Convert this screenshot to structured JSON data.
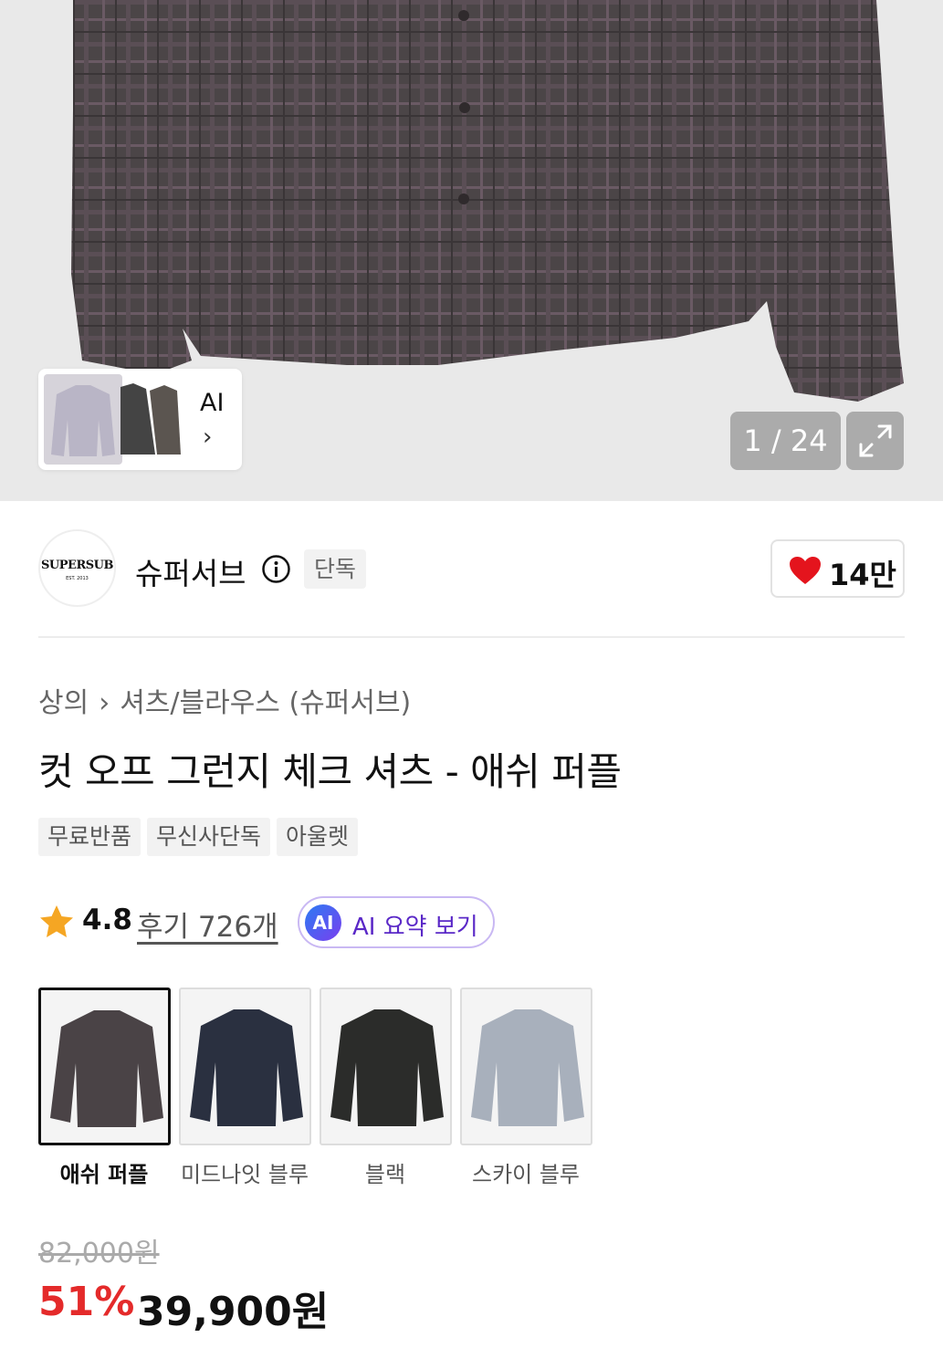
{
  "gallery": {
    "ai_label": "AI",
    "counter": "1 / 24"
  },
  "brand": {
    "logo_text": "SUPERSUB",
    "logo_subtext": "EST. 2013",
    "name": "슈퍼서브",
    "exclusive_badge": "단독",
    "like_count": "14만"
  },
  "breadcrumb": {
    "category": "상의",
    "subcategory": "셔츠/블라우스 (슈퍼서브)"
  },
  "product": {
    "title": "컷 오프 그런지 체크 셔츠 - 애쉬 퍼플",
    "tags": [
      "무료반품",
      "무신사단독",
      "아울렛"
    ],
    "rating": "4.8",
    "reviews": "후기 726개",
    "ai_summary_badge": "AI",
    "ai_summary_label": "AI 요약 보기"
  },
  "options": [
    {
      "label": "애쉬 퍼플",
      "color": "#4a4346",
      "selected": true
    },
    {
      "label": "미드나잇 블루",
      "color": "#2a3040",
      "selected": false
    },
    {
      "label": "블랙",
      "color": "#2b2c2a",
      "selected": false
    },
    {
      "label": "스카이 블루",
      "color": "#a8b0bc",
      "selected": false
    }
  ],
  "price": {
    "original": "82,000원",
    "discount": "51%",
    "final": "39,900원"
  },
  "colors": {
    "heart": "#e4141d",
    "discount": "#e42a2a",
    "ai_purple": "#5a28c7"
  }
}
